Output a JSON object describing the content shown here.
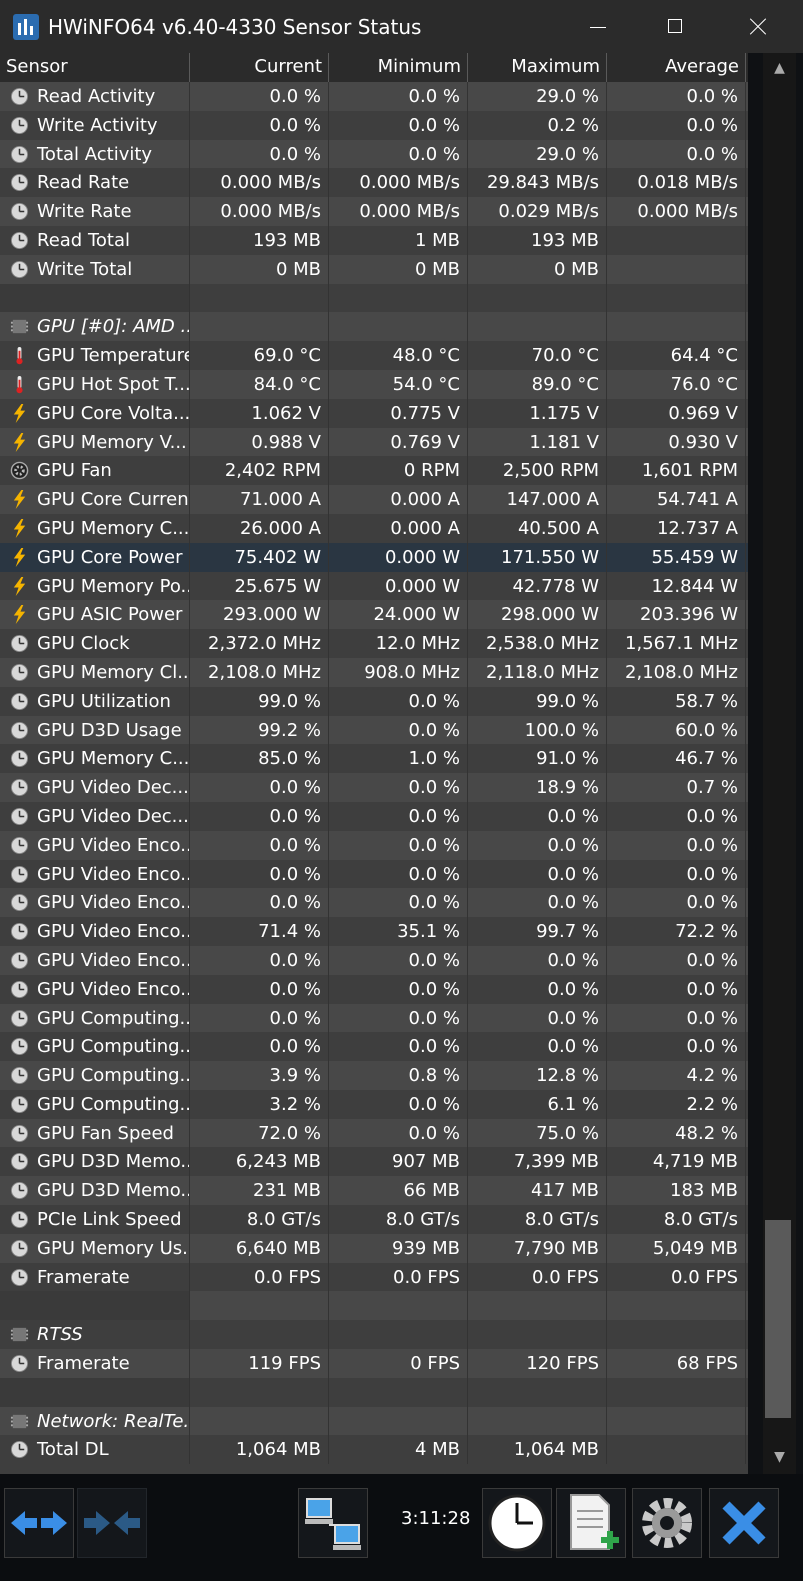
{
  "window": {
    "title": "HWiNFO64 v6.40-4330 Sensor Status"
  },
  "columns": [
    "Sensor",
    "Current",
    "Minimum",
    "Maximum",
    "Average"
  ],
  "rows": [
    {
      "type": "sensor",
      "icon": "clock-gauge",
      "label": "Read Activity",
      "current": "0.0 %",
      "min": "0.0 %",
      "max": "29.0 %",
      "avg": "0.0 %"
    },
    {
      "type": "sensor",
      "icon": "clock-gauge",
      "label": "Write Activity",
      "current": "0.0 %",
      "min": "0.0 %",
      "max": "0.2 %",
      "avg": "0.0 %"
    },
    {
      "type": "sensor",
      "icon": "clock-gauge",
      "label": "Total Activity",
      "current": "0.0 %",
      "min": "0.0 %",
      "max": "29.0 %",
      "avg": "0.0 %"
    },
    {
      "type": "sensor",
      "icon": "clock-gauge",
      "label": "Read Rate",
      "current": "0.000 MB/s",
      "min": "0.000 MB/s",
      "max": "29.843 MB/s",
      "avg": "0.018 MB/s"
    },
    {
      "type": "sensor",
      "icon": "clock-gauge",
      "label": "Write Rate",
      "current": "0.000 MB/s",
      "min": "0.000 MB/s",
      "max": "0.029 MB/s",
      "avg": "0.000 MB/s"
    },
    {
      "type": "sensor",
      "icon": "clock-gauge",
      "label": "Read Total",
      "current": "193 MB",
      "min": "1 MB",
      "max": "193 MB",
      "avg": ""
    },
    {
      "type": "sensor",
      "icon": "clock-gauge",
      "label": "Write Total",
      "current": "0 MB",
      "min": "0 MB",
      "max": "0 MB",
      "avg": ""
    },
    {
      "type": "blank"
    },
    {
      "type": "group",
      "icon": "chip",
      "label": "GPU [#0]: AMD ..."
    },
    {
      "type": "sensor",
      "icon": "thermometer",
      "label": "GPU Temperature",
      "current": "69.0 °C",
      "min": "48.0 °C",
      "max": "70.0 °C",
      "avg": "64.4 °C"
    },
    {
      "type": "sensor",
      "icon": "thermometer",
      "label": "GPU Hot Spot T...",
      "current": "84.0 °C",
      "min": "54.0 °C",
      "max": "89.0 °C",
      "avg": "76.0 °C"
    },
    {
      "type": "sensor",
      "icon": "lightning",
      "label": "GPU Core Volta...",
      "current": "1.062 V",
      "min": "0.775 V",
      "max": "1.175 V",
      "avg": "0.969 V"
    },
    {
      "type": "sensor",
      "icon": "lightning",
      "label": "GPU Memory V...",
      "current": "0.988 V",
      "min": "0.769 V",
      "max": "1.181 V",
      "avg": "0.930 V"
    },
    {
      "type": "sensor",
      "icon": "fan",
      "label": "GPU Fan",
      "current": "2,402 RPM",
      "min": "0 RPM",
      "max": "2,500 RPM",
      "avg": "1,601 RPM"
    },
    {
      "type": "sensor",
      "icon": "lightning",
      "label": "GPU Core Current",
      "current": "71.000 A",
      "min": "0.000 A",
      "max": "147.000 A",
      "avg": "54.741 A"
    },
    {
      "type": "sensor",
      "icon": "lightning",
      "label": "GPU Memory C...",
      "current": "26.000 A",
      "min": "0.000 A",
      "max": "40.500 A",
      "avg": "12.737 A"
    },
    {
      "type": "sensor",
      "icon": "lightning",
      "label": "GPU Core Power",
      "current": "75.402 W",
      "min": "0.000 W",
      "max": "171.550 W",
      "avg": "55.459 W",
      "highlight": true
    },
    {
      "type": "sensor",
      "icon": "lightning",
      "label": "GPU Memory Po...",
      "current": "25.675 W",
      "min": "0.000 W",
      "max": "42.778 W",
      "avg": "12.844 W"
    },
    {
      "type": "sensor",
      "icon": "lightning",
      "label": "GPU ASIC Power",
      "current": "293.000 W",
      "min": "24.000 W",
      "max": "298.000 W",
      "avg": "203.396 W"
    },
    {
      "type": "sensor",
      "icon": "clock-gauge",
      "label": "GPU Clock",
      "current": "2,372.0 MHz",
      "min": "12.0 MHz",
      "max": "2,538.0 MHz",
      "avg": "1,567.1 MHz"
    },
    {
      "type": "sensor",
      "icon": "clock-gauge",
      "label": "GPU Memory Cl...",
      "current": "2,108.0 MHz",
      "min": "908.0 MHz",
      "max": "2,118.0 MHz",
      "avg": "2,108.0 MHz"
    },
    {
      "type": "sensor",
      "icon": "clock-gauge",
      "label": "GPU Utilization",
      "current": "99.0 %",
      "min": "0.0 %",
      "max": "99.0 %",
      "avg": "58.7 %"
    },
    {
      "type": "sensor",
      "icon": "clock-gauge",
      "label": "GPU D3D Usage",
      "current": "99.2 %",
      "min": "0.0 %",
      "max": "100.0 %",
      "avg": "60.0 %"
    },
    {
      "type": "sensor",
      "icon": "clock-gauge",
      "label": "GPU Memory C...",
      "current": "85.0 %",
      "min": "1.0 %",
      "max": "91.0 %",
      "avg": "46.7 %"
    },
    {
      "type": "sensor",
      "icon": "clock-gauge",
      "label": "GPU Video Dec...",
      "current": "0.0 %",
      "min": "0.0 %",
      "max": "18.9 %",
      "avg": "0.7 %"
    },
    {
      "type": "sensor",
      "icon": "clock-gauge",
      "label": "GPU Video Dec...",
      "current": "0.0 %",
      "min": "0.0 %",
      "max": "0.0 %",
      "avg": "0.0 %"
    },
    {
      "type": "sensor",
      "icon": "clock-gauge",
      "label": "GPU Video Enco...",
      "current": "0.0 %",
      "min": "0.0 %",
      "max": "0.0 %",
      "avg": "0.0 %"
    },
    {
      "type": "sensor",
      "icon": "clock-gauge",
      "label": "GPU Video Enco...",
      "current": "0.0 %",
      "min": "0.0 %",
      "max": "0.0 %",
      "avg": "0.0 %"
    },
    {
      "type": "sensor",
      "icon": "clock-gauge",
      "label": "GPU Video Enco...",
      "current": "0.0 %",
      "min": "0.0 %",
      "max": "0.0 %",
      "avg": "0.0 %"
    },
    {
      "type": "sensor",
      "icon": "clock-gauge",
      "label": "GPU Video Enco...",
      "current": "71.4 %",
      "min": "35.1 %",
      "max": "99.7 %",
      "avg": "72.2 %"
    },
    {
      "type": "sensor",
      "icon": "clock-gauge",
      "label": "GPU Video Enco...",
      "current": "0.0 %",
      "min": "0.0 %",
      "max": "0.0 %",
      "avg": "0.0 %"
    },
    {
      "type": "sensor",
      "icon": "clock-gauge",
      "label": "GPU Video Enco...",
      "current": "0.0 %",
      "min": "0.0 %",
      "max": "0.0 %",
      "avg": "0.0 %"
    },
    {
      "type": "sensor",
      "icon": "clock-gauge",
      "label": "GPU Computing...",
      "current": "0.0 %",
      "min": "0.0 %",
      "max": "0.0 %",
      "avg": "0.0 %"
    },
    {
      "type": "sensor",
      "icon": "clock-gauge",
      "label": "GPU Computing...",
      "current": "0.0 %",
      "min": "0.0 %",
      "max": "0.0 %",
      "avg": "0.0 %"
    },
    {
      "type": "sensor",
      "icon": "clock-gauge",
      "label": "GPU Computing...",
      "current": "3.9 %",
      "min": "0.8 %",
      "max": "12.8 %",
      "avg": "4.2 %"
    },
    {
      "type": "sensor",
      "icon": "clock-gauge",
      "label": "GPU Computing...",
      "current": "3.2 %",
      "min": "0.0 %",
      "max": "6.1 %",
      "avg": "2.2 %"
    },
    {
      "type": "sensor",
      "icon": "clock-gauge",
      "label": "GPU Fan Speed",
      "current": "72.0 %",
      "min": "0.0 %",
      "max": "75.0 %",
      "avg": "48.2 %"
    },
    {
      "type": "sensor",
      "icon": "clock-gauge",
      "label": "GPU D3D Memo...",
      "current": "6,243 MB",
      "min": "907 MB",
      "max": "7,399 MB",
      "avg": "4,719 MB"
    },
    {
      "type": "sensor",
      "icon": "clock-gauge",
      "label": "GPU D3D Memo...",
      "current": "231 MB",
      "min": "66 MB",
      "max": "417 MB",
      "avg": "183 MB"
    },
    {
      "type": "sensor",
      "icon": "clock-gauge",
      "label": "PCIe Link Speed",
      "current": "8.0 GT/s",
      "min": "8.0 GT/s",
      "max": "8.0 GT/s",
      "avg": "8.0 GT/s"
    },
    {
      "type": "sensor",
      "icon": "clock-gauge",
      "label": "GPU Memory Us...",
      "current": "6,640 MB",
      "min": "939 MB",
      "max": "7,790 MB",
      "avg": "5,049 MB"
    },
    {
      "type": "sensor",
      "icon": "clock-gauge",
      "label": "Framerate",
      "current": "0.0 FPS",
      "min": "0.0 FPS",
      "max": "0.0 FPS",
      "avg": "0.0 FPS"
    },
    {
      "type": "blank"
    },
    {
      "type": "group",
      "icon": "chip",
      "label": "RTSS"
    },
    {
      "type": "sensor",
      "icon": "clock-gauge",
      "label": "Framerate",
      "current": "119 FPS",
      "min": "0 FPS",
      "max": "120 FPS",
      "avg": "68 FPS"
    },
    {
      "type": "blank"
    },
    {
      "type": "group",
      "icon": "chip",
      "label": "Network: RealTe..."
    },
    {
      "type": "sensor",
      "icon": "clock-gauge",
      "label": "Total DL",
      "current": "1,064 MB",
      "min": "4 MB",
      "max": "1,064 MB",
      "avg": ""
    }
  ],
  "toolbar": {
    "elapsed_time": "3:11:28"
  },
  "colors": {
    "titlebar": "#2b2b2b",
    "row_odd": "#484848",
    "row_even": "#3e3e3e",
    "highlight": "#2a3642",
    "bottom": "#0b0d10",
    "accent_blue": "#3a8ee6"
  }
}
